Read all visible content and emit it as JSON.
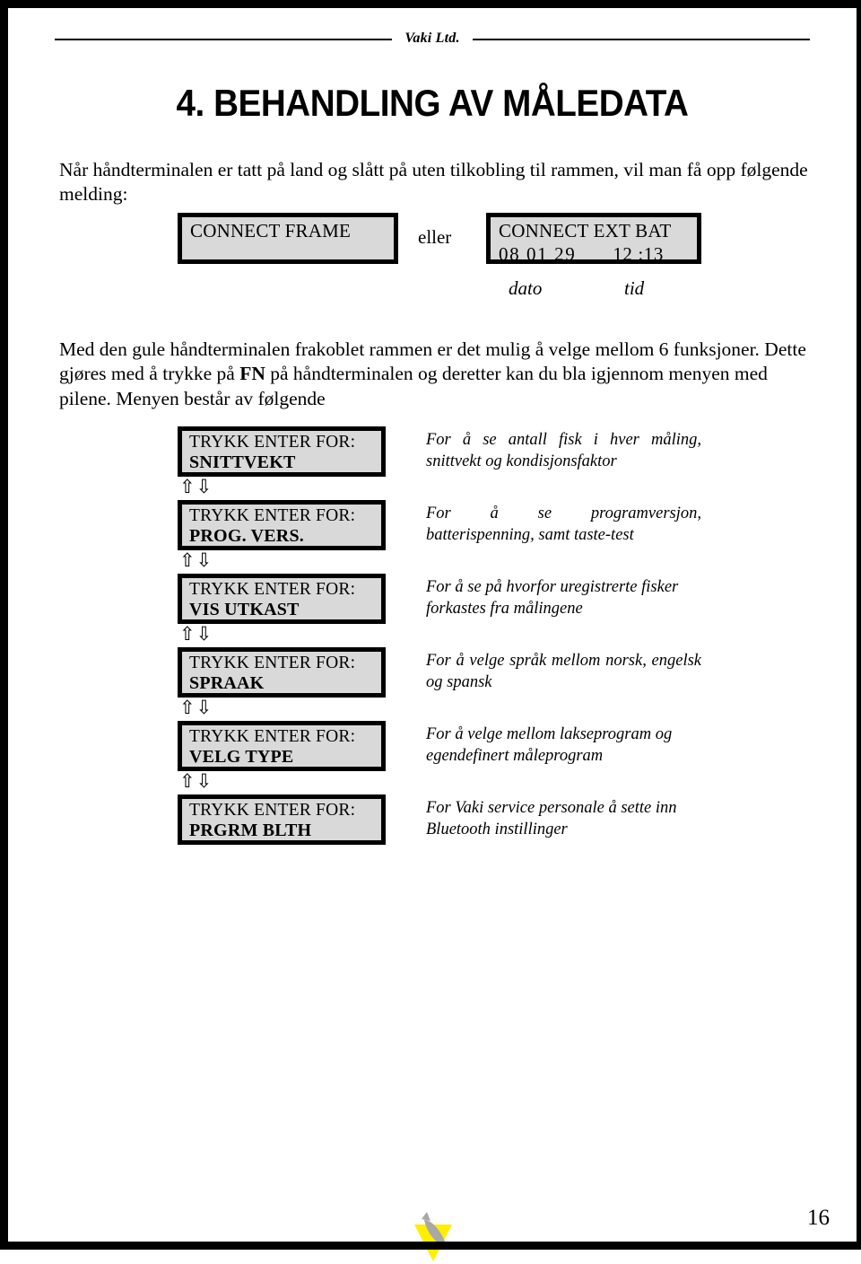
{
  "page": {
    "header_mark": "Vaki Ltd.",
    "chapter_title": "4. BEHANDLING AV MÅLEDATA",
    "page_number": "16"
  },
  "intro": {
    "paragraph": "Når håndterminalen er tatt på land og slått på uten tilkobling til rammen, vil man få opp følgende melding:"
  },
  "displays": {
    "connect_frame": "CONNECT FRAME",
    "separator": "eller",
    "connect_ext_bat": {
      "line1": "CONNECT EXT BAT",
      "date": "08  01  29",
      "time": "12 :13"
    },
    "label_date": "dato",
    "label_time": "tid"
  },
  "body": {
    "paragraph": "Med den gule håndterminalen frakoblet rammen er det mulig å velge mellom 6 funksjoner. Dette gjøres med å trykke på FN på håndterminalen og deretter kan du bla igjennom menyen med pilene. Menyen består av følgende",
    "bold_token": "FN"
  },
  "menu": {
    "prompt_prefix": "TRYKK ENTER FOR:",
    "arrows": "⇧⇩",
    "items": [
      {
        "line1": "TRYKK ENTER FOR:",
        "line2": "SNITTVEKT",
        "description": "For å se antall fisk i hver måling, snittvekt og kondisjonsfaktor"
      },
      {
        "line1": "TRYKK ENTER FOR:",
        "line2": "PROG. VERS.",
        "description": "For å se programversjon, batterispenning, samt taste-test"
      },
      {
        "line1": "TRYKK ENTER FOR:",
        "line2": "VIS UTKAST",
        "description": "For å se på hvorfor uregistrerte fisker forkastes fra målingene"
      },
      {
        "line1": "TRYKK ENTER FOR:",
        "line2": "SPRAAK",
        "description": "For å velge språk mellom norsk, engelsk og spansk"
      },
      {
        "line1": "TRYKK ENTER FOR:",
        "line2": "VELG TYPE",
        "description": "For å velge mellom lakseprogram og egendefinert måleprogram"
      },
      {
        "line1": "TRYKK ENTER FOR:",
        "line2": "PRGRM BLTH",
        "description": "For Vaki service personale å sette inn Bluetooth instillinger"
      }
    ]
  },
  "colors": {
    "lcd_fill": "#d9d9d9",
    "lcd_border": "#000000",
    "logo_triangle": "#ffee00",
    "logo_fish": "#a8a8a8",
    "page_background": "#ffffff"
  }
}
